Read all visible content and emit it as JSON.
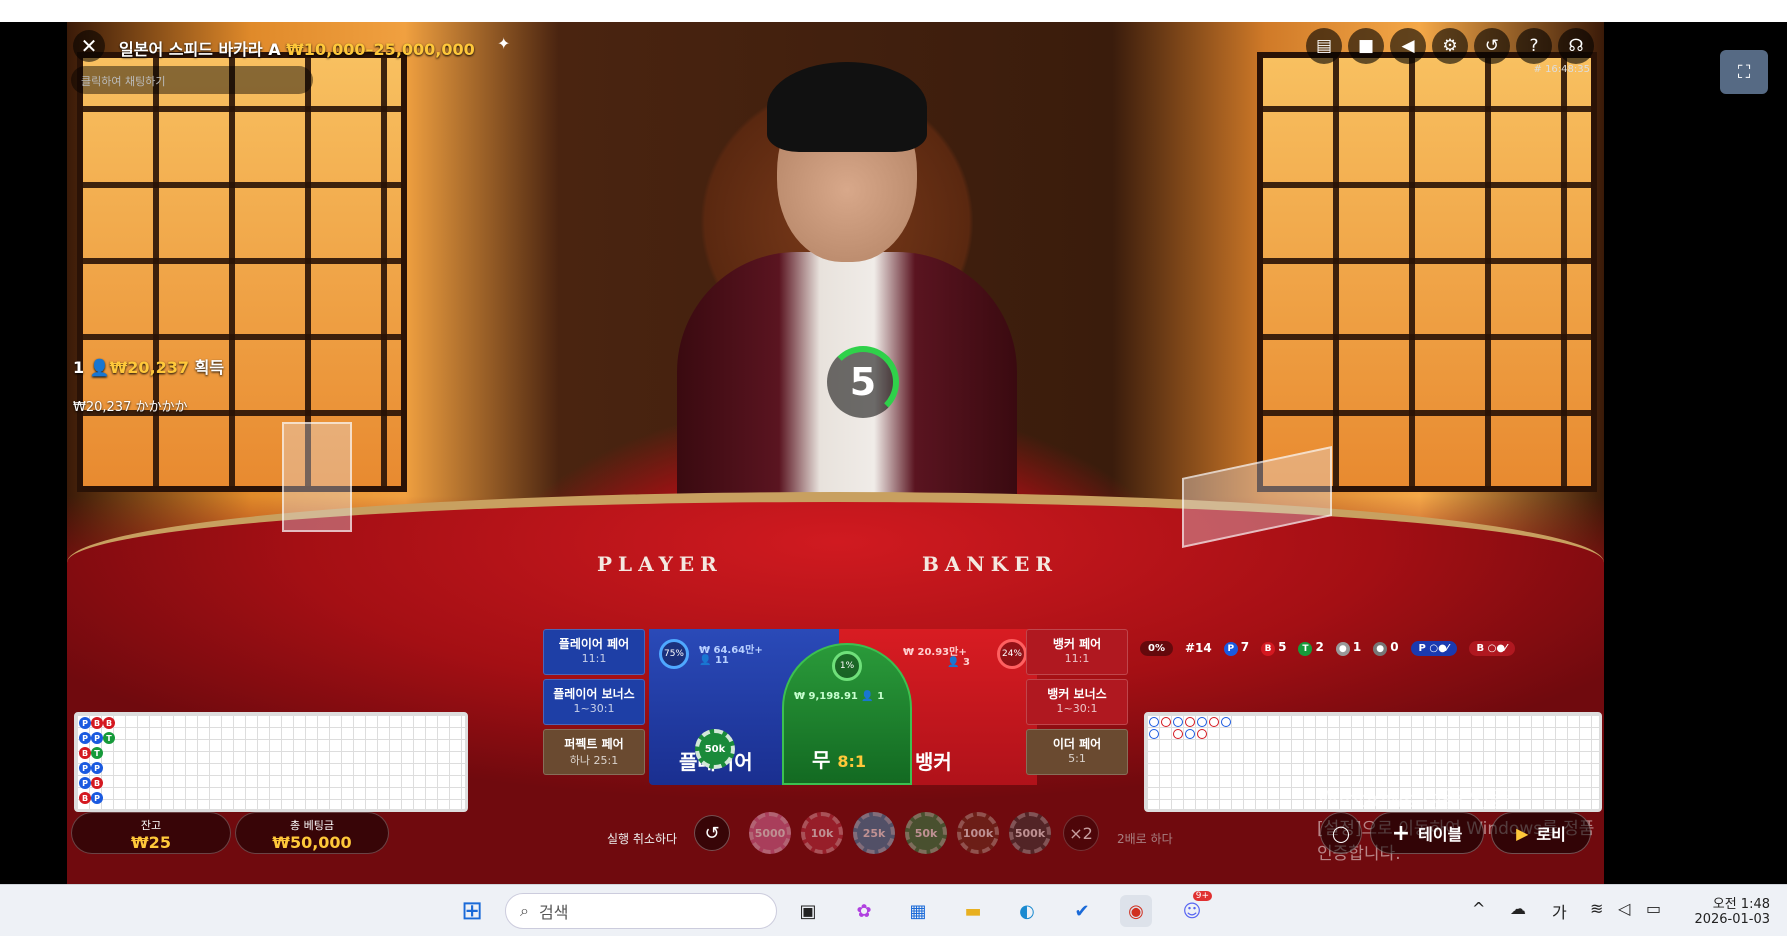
{
  "header": {
    "title": "일본어 스피드 바카라 A",
    "limits": "₩10,000–25,000,000",
    "chat_placeholder": "클릭하여 채팅하기",
    "clock": "# 16:48:35"
  },
  "icons": {
    "close": "close-icon",
    "star": "sparkle-icon",
    "header": [
      "chat-icon",
      "video-icon",
      "volume-icon",
      "gear-icon",
      "history-icon",
      "help-icon",
      "headset-icon"
    ],
    "fullscreen": "fullscreen-icon"
  },
  "winner": {
    "count": "1",
    "icon": "user-icon",
    "amount": "₩20,237",
    "label": "획득",
    "sub_amount": "₩20,237",
    "sub_name": "かかかか"
  },
  "timer": {
    "value": "5"
  },
  "felt": {
    "player": "PLAYER",
    "banker": "BANKER"
  },
  "side_bets": {
    "player_pair": {
      "label": "플레이어 페어",
      "odds": "11:1"
    },
    "player_bonus": {
      "label": "플레이어 보너스",
      "odds": "1~30:1"
    },
    "perfect_pair": {
      "label": "퍼펙트 페어",
      "odds": "하나 25:1"
    },
    "banker_pair": {
      "label": "뱅커 페어",
      "odds": "11:1"
    },
    "banker_bonus": {
      "label": "뱅커 보너스",
      "odds": "1~30:1"
    },
    "either_pair": {
      "label": "이더 페어",
      "odds": "5:1"
    }
  },
  "main_bets": {
    "player": {
      "label": "플레이어",
      "pct": "75%",
      "stake": "₩ 64.64만+",
      "players": "11",
      "chip": "50k"
    },
    "tie": {
      "label": "무",
      "odds": "8:1",
      "pct": "1%",
      "stake": "₩ 9,198.91",
      "players": "1"
    },
    "banker": {
      "label": "뱅커",
      "pct": "24%",
      "stake": "₩ 20.93만+",
      "players": "3"
    }
  },
  "stats": {
    "round": "#14",
    "pct": "0%",
    "player": "7",
    "banker": "5",
    "tie": "2",
    "player_pair": "1",
    "banker_pair": "0",
    "ask_p": "P",
    "ask_b": "B"
  },
  "bead_road": [
    [
      "P",
      "B",
      "B"
    ],
    [
      "P",
      "P",
      "T"
    ],
    [
      "B",
      "T"
    ],
    [
      "P",
      "P"
    ],
    [
      "P",
      "B"
    ],
    [
      "B",
      "P"
    ]
  ],
  "balance": {
    "label": "잔고",
    "value": "₩25"
  },
  "total_bet": {
    "label": "총 베팅금",
    "value": "₩50,000"
  },
  "controls": {
    "undo_label": "실행 취소하다",
    "double_label": "2배로 하다",
    "double_btn": "×2"
  },
  "chips": [
    "5000",
    "10k",
    "25k",
    "50k",
    "100k",
    "500k"
  ],
  "buttons": {
    "table": "테이블",
    "lobby": "로비"
  },
  "watermark": {
    "title": "Windows 정품 인증",
    "subtitle": "[설정]으로 이동하여 Windows를 정품 인증합니다."
  },
  "taskbar": {
    "search": "검색",
    "ime": "가",
    "time": "오전 1:48",
    "date": "2026-01-03",
    "discord_badge": "9+"
  },
  "colors": {
    "player": "#1e3fa6",
    "banker": "#d41820",
    "tie": "#169a3a",
    "gold": "#ffc83a"
  }
}
